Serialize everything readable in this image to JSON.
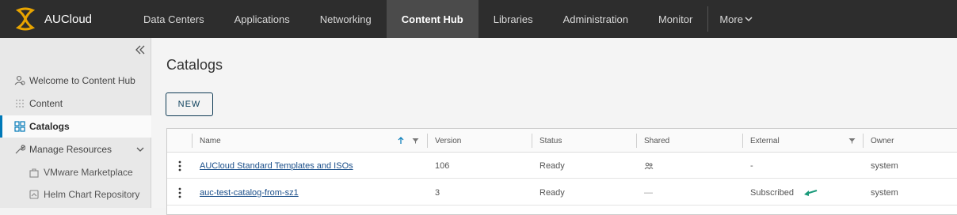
{
  "app": {
    "name": "AUCloud"
  },
  "nav": {
    "items": [
      {
        "label": "Data Centers"
      },
      {
        "label": "Applications"
      },
      {
        "label": "Networking"
      },
      {
        "label": "Content Hub"
      },
      {
        "label": "Libraries"
      },
      {
        "label": "Administration"
      },
      {
        "label": "Monitor"
      }
    ],
    "active": "Content Hub",
    "more_label": "More"
  },
  "sidebar": {
    "items": [
      {
        "label": "Welcome to Content Hub",
        "icon": "welcome-icon"
      },
      {
        "label": "Content",
        "icon": "content-grid-icon"
      },
      {
        "label": "Catalogs",
        "icon": "catalogs-icon",
        "active": true
      },
      {
        "label": "Manage Resources",
        "icon": "wrench-icon",
        "expanded": true
      },
      {
        "label": "VMware Marketplace",
        "icon": "bag-icon"
      },
      {
        "label": "Helm Chart Repository",
        "icon": "chart-repo-icon"
      }
    ]
  },
  "main": {
    "title": "Catalogs",
    "new_button": "NEW",
    "columns": [
      "Name",
      "Version",
      "Status",
      "Shared",
      "External",
      "Owner"
    ],
    "rows": [
      {
        "name": "AUCloud Standard Templates and ISOs",
        "version": "106",
        "status": "Ready",
        "shared": "shared-users-icon",
        "external": "-",
        "owner": "system"
      },
      {
        "name": "auc-test-catalog-from-sz1",
        "version": "3",
        "status": "Ready",
        "shared": "—",
        "external": "Subscribed",
        "owner": "system"
      }
    ]
  },
  "colors": {
    "topbar": "#2d2d2d",
    "accent": "#0079b8",
    "arrow": "#1a9a7a"
  }
}
